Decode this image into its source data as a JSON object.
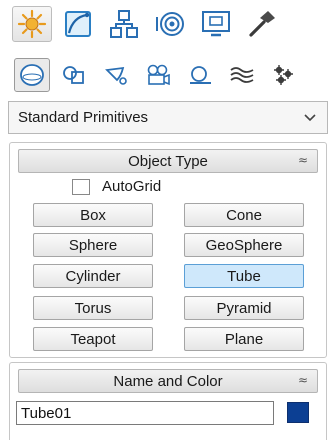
{
  "command_tabs": [
    {
      "name": "create",
      "icon": "create-star-icon",
      "active": true
    },
    {
      "name": "modify",
      "icon": "modify-curve-icon"
    },
    {
      "name": "hierarchy",
      "icon": "hierarchy-icon"
    },
    {
      "name": "motion",
      "icon": "motion-icon"
    },
    {
      "name": "display",
      "icon": "display-monitor-icon"
    },
    {
      "name": "utilities",
      "icon": "utilities-hammer-icon"
    }
  ],
  "categories": [
    {
      "name": "geometry",
      "icon": "sphere-icon",
      "active": true
    },
    {
      "name": "shapes",
      "icon": "shapes-icon"
    },
    {
      "name": "lights",
      "icon": "lights-icon"
    },
    {
      "name": "cameras",
      "icon": "camera-icon"
    },
    {
      "name": "helpers",
      "icon": "helpers-icon"
    },
    {
      "name": "space_warps",
      "icon": "space-warps-icon"
    },
    {
      "name": "systems",
      "icon": "systems-icon"
    }
  ],
  "primitive_type": {
    "selected": "Standard Primitives"
  },
  "object_type": {
    "title": "Object Type",
    "collapse_glyph": "≈",
    "autogrid_label": "AutoGrid",
    "autogrid_checked": false,
    "buttons": [
      "Box",
      "Cone",
      "Sphere",
      "GeoSphere",
      "Cylinder",
      "Tube",
      "Torus",
      "Pyramid",
      "Teapot",
      "Plane"
    ],
    "selected": "Tube"
  },
  "name_and_color": {
    "title": "Name and Color",
    "collapse_glyph": "≈",
    "name_value": "Tube01",
    "color": "#0c3f93"
  },
  "colors": {
    "selected_button": "#cfe8fb",
    "accent_blue": "#1f74c9",
    "star_orange": "#e89a1c"
  }
}
